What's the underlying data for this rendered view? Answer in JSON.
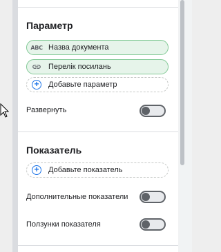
{
  "parameter_section": {
    "title": "Параметр",
    "fields": [
      {
        "icon": "text-type-icon",
        "icon_text": "ABC",
        "label": "Назва документа"
      },
      {
        "icon": "link-icon",
        "label": "Перелік посилань"
      }
    ],
    "add_label": "Добавьте параметр",
    "expand_label": "Развернуть"
  },
  "metric_section": {
    "title": "Показатель",
    "add_label": "Добавьте показатель",
    "toggles": [
      {
        "label": "Дополнительные показатели"
      },
      {
        "label": "Ползунки показателя"
      }
    ]
  },
  "colors": {
    "field_chip_bg": "#e6f4ea",
    "field_chip_border": "#81c995",
    "accent": "#1a73e8"
  }
}
